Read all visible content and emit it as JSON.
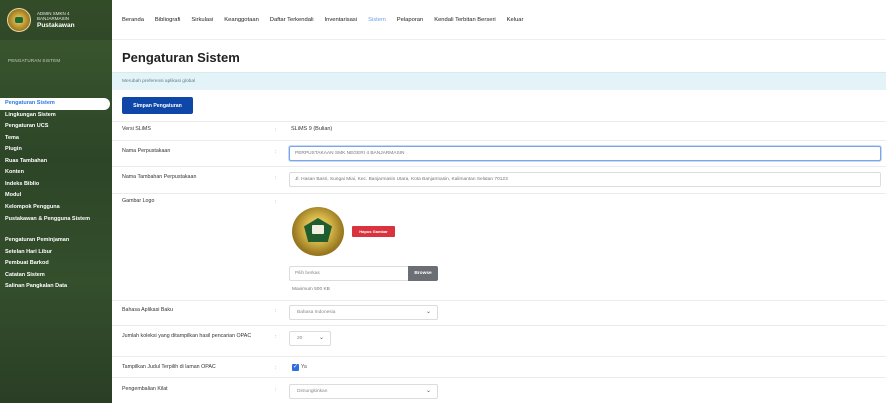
{
  "sidebar": {
    "org_line1": "ADMIN SMKN 4",
    "org_line2": "BANJARMASIN",
    "app_name": "Pustakawan",
    "section_title": "PENGATURAN SISTEM",
    "items": [
      {
        "label": "Pengaturan Sistem",
        "active": true
      },
      {
        "label": "Lingkungan Sistem"
      },
      {
        "label": "Pengaturan UCS"
      },
      {
        "label": "Tema"
      },
      {
        "label": "Plugin"
      },
      {
        "label": "Ruas Tambahan"
      },
      {
        "label": "Konten"
      },
      {
        "label": "Indeks Biblio"
      },
      {
        "label": "Modul"
      },
      {
        "label": "Kelompok Pengguna"
      },
      {
        "label": "Pustakawan & Pengguna Sistem"
      },
      {
        "label": "Pengaturan Peminjaman"
      },
      {
        "label": "Setelan Hari Libur"
      },
      {
        "label": "Pembuat Barkod"
      },
      {
        "label": "Catatan Sistem"
      },
      {
        "label": "Salinan Pangkalan Data"
      }
    ]
  },
  "topnav": {
    "items": [
      {
        "label": "Beranda"
      },
      {
        "label": "Bibliografi"
      },
      {
        "label": "Sirkulasi"
      },
      {
        "label": "Keanggotaan"
      },
      {
        "label": "Daftar Terkendali"
      },
      {
        "label": "Inventarisasi"
      },
      {
        "label": "Sistem",
        "active": true
      },
      {
        "label": "Pelaporan"
      },
      {
        "label": "Kendali Terbitan Berseri"
      },
      {
        "label": "Keluar"
      }
    ]
  },
  "page": {
    "title": "Pengaturan Sistem",
    "info": "Merubah preferensi aplikasi global",
    "save_label": "Simpan Pengaturan"
  },
  "form": {
    "version_label": "Versi SLiMS",
    "version_value": "SLiMS 9 (Bulian)",
    "lib_name_label": "Nama Perpustakaan",
    "lib_name_value": "PERPUSTAKAAN SMK NEGERI 4 BANJARMASIN",
    "lib_subname_label": "Nama Tambahan Perpustakaan",
    "lib_subname_value": "Jl. Hasan Basri, Sungai Miai, Kec. Banjarmasin Utara, Kota Banjarmasin, Kalimantan Selatan 70123",
    "logo_label": "Gambar Logo",
    "remove_image_label": "Hapus Gambar",
    "file_placeholder": "Pilih berkas",
    "browse_label": "Browse",
    "max_size_note": "Maximum 500 KB",
    "lang_label": "Bahasa Aplikasi Baku",
    "lang_value": "Bahasa Indonesia",
    "opac_count_label": "Jumlah koleksi yang ditampilkan hasil pencarian OPAC",
    "opac_count_value": "20",
    "promoted_label": "Tampilkan Judul Terpilih di laman OPAC",
    "promoted_value": "Ya",
    "quick_return_label": "Pengembalian Kilat",
    "quick_return_value": "Dimungkinkan",
    "colon": ":"
  }
}
